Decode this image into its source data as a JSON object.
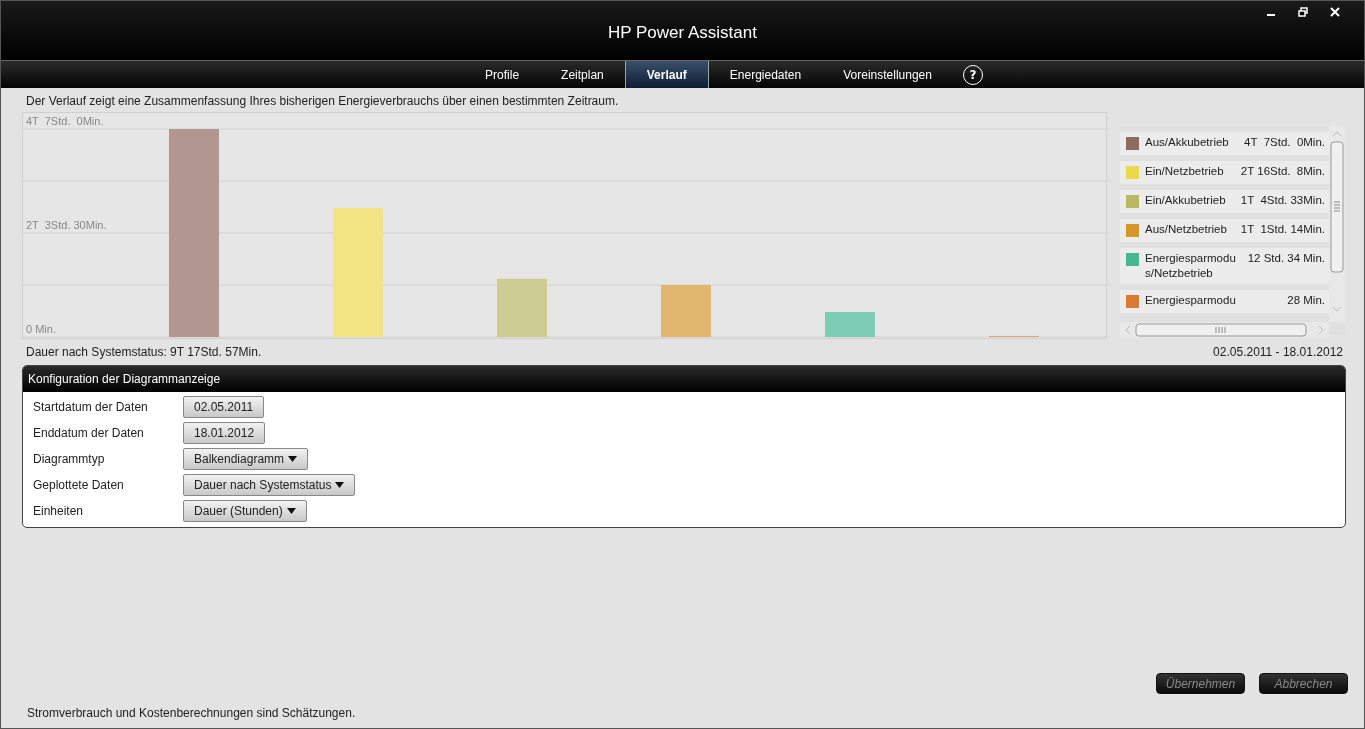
{
  "window": {
    "title": "HP Power Assistant"
  },
  "tabs": [
    {
      "label": "Profile",
      "selected": false
    },
    {
      "label": "Zeitplan",
      "selected": false
    },
    {
      "label": "Verlauf",
      "selected": true
    },
    {
      "label": "Energiedaten",
      "selected": false
    },
    {
      "label": "Voreinstellungen",
      "selected": false
    }
  ],
  "help_button": "?",
  "description": "Der Verlauf zeigt eine Zusammenfassung Ihres bisherigen Energieverbrauchs über einen bestimmten Zeitraum.",
  "chart": {
    "axis_labels": [
      "4T  7Std.  0Min.",
      "2T  3Std. 30Min.",
      "0 Min."
    ]
  },
  "legend": [
    {
      "label": "Aus/Akkubetrieb",
      "value": "4T  7Std.  0Min.",
      "color": "#8f6a61"
    },
    {
      "label": "Ein/Netzbetrieb",
      "value": "2T 16Std.  8Min.",
      "color": "#ecd94c"
    },
    {
      "label": "Ein/Akkubetrieb",
      "value": "1T  4Std. 33Min.",
      "color": "#b8b865"
    },
    {
      "label": "Aus/Netzbetrieb",
      "value": "1T  1Std. 14Min.",
      "color": "#d4962e"
    },
    {
      "label": "Energiesparmodus/Netzbetrieb",
      "value": "12 Std. 34 Min.",
      "color": "#44b893"
    },
    {
      "label": "Energiesparmodu",
      "value": "28 Min.",
      "color": "#d97b35"
    }
  ],
  "summary": "Dauer nach Systemstatus: 9T 17Std. 57Min.",
  "date_range": "02.05.2011 - 18.01.2012",
  "config": {
    "title": "Konfiguration der Diagrammanzeige",
    "rows": [
      {
        "label": "Startdatum der Daten",
        "value": "02.05.2011",
        "kind": "date"
      },
      {
        "label": "Enddatum der Daten",
        "value": "18.01.2012",
        "kind": "date"
      },
      {
        "label": "Diagrammtyp",
        "value": "Balkendiagramm",
        "kind": "dropdown"
      },
      {
        "label": "Geplottete Daten",
        "value": "Dauer nach Systemstatus",
        "kind": "dropdown"
      },
      {
        "label": "Einheiten",
        "value": "Dauer (Stunden)",
        "kind": "dropdown"
      }
    ]
  },
  "buttons": [
    {
      "label": "Übernehmen",
      "disabled": true
    },
    {
      "label": "Abbrechen",
      "disabled": true
    }
  ],
  "footer": "Stromverbrauch und Kostenberechnungen sind Schätzungen."
}
